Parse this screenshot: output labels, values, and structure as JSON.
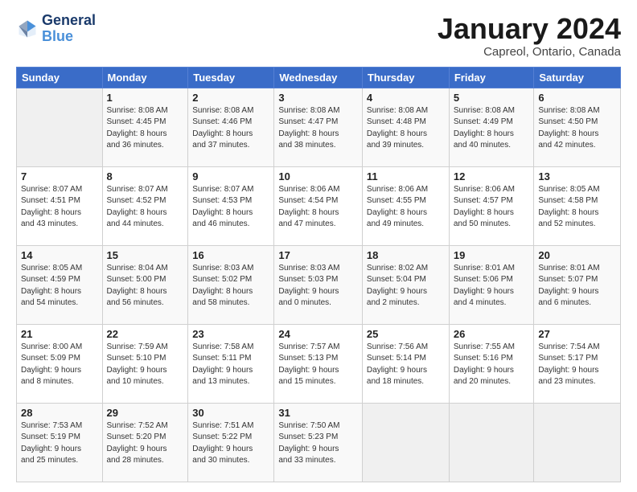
{
  "header": {
    "logo_line1": "General",
    "logo_line2": "Blue",
    "month_title": "January 2024",
    "location": "Capreol, Ontario, Canada"
  },
  "weekdays": [
    "Sunday",
    "Monday",
    "Tuesday",
    "Wednesday",
    "Thursday",
    "Friday",
    "Saturday"
  ],
  "weeks": [
    [
      {
        "day": "",
        "info": ""
      },
      {
        "day": "1",
        "info": "Sunrise: 8:08 AM\nSunset: 4:45 PM\nDaylight: 8 hours\nand 36 minutes."
      },
      {
        "day": "2",
        "info": "Sunrise: 8:08 AM\nSunset: 4:46 PM\nDaylight: 8 hours\nand 37 minutes."
      },
      {
        "day": "3",
        "info": "Sunrise: 8:08 AM\nSunset: 4:47 PM\nDaylight: 8 hours\nand 38 minutes."
      },
      {
        "day": "4",
        "info": "Sunrise: 8:08 AM\nSunset: 4:48 PM\nDaylight: 8 hours\nand 39 minutes."
      },
      {
        "day": "5",
        "info": "Sunrise: 8:08 AM\nSunset: 4:49 PM\nDaylight: 8 hours\nand 40 minutes."
      },
      {
        "day": "6",
        "info": "Sunrise: 8:08 AM\nSunset: 4:50 PM\nDaylight: 8 hours\nand 42 minutes."
      }
    ],
    [
      {
        "day": "7",
        "info": "Sunrise: 8:07 AM\nSunset: 4:51 PM\nDaylight: 8 hours\nand 43 minutes."
      },
      {
        "day": "8",
        "info": "Sunrise: 8:07 AM\nSunset: 4:52 PM\nDaylight: 8 hours\nand 44 minutes."
      },
      {
        "day": "9",
        "info": "Sunrise: 8:07 AM\nSunset: 4:53 PM\nDaylight: 8 hours\nand 46 minutes."
      },
      {
        "day": "10",
        "info": "Sunrise: 8:06 AM\nSunset: 4:54 PM\nDaylight: 8 hours\nand 47 minutes."
      },
      {
        "day": "11",
        "info": "Sunrise: 8:06 AM\nSunset: 4:55 PM\nDaylight: 8 hours\nand 49 minutes."
      },
      {
        "day": "12",
        "info": "Sunrise: 8:06 AM\nSunset: 4:57 PM\nDaylight: 8 hours\nand 50 minutes."
      },
      {
        "day": "13",
        "info": "Sunrise: 8:05 AM\nSunset: 4:58 PM\nDaylight: 8 hours\nand 52 minutes."
      }
    ],
    [
      {
        "day": "14",
        "info": "Sunrise: 8:05 AM\nSunset: 4:59 PM\nDaylight: 8 hours\nand 54 minutes."
      },
      {
        "day": "15",
        "info": "Sunrise: 8:04 AM\nSunset: 5:00 PM\nDaylight: 8 hours\nand 56 minutes."
      },
      {
        "day": "16",
        "info": "Sunrise: 8:03 AM\nSunset: 5:02 PM\nDaylight: 8 hours\nand 58 minutes."
      },
      {
        "day": "17",
        "info": "Sunrise: 8:03 AM\nSunset: 5:03 PM\nDaylight: 9 hours\nand 0 minutes."
      },
      {
        "day": "18",
        "info": "Sunrise: 8:02 AM\nSunset: 5:04 PM\nDaylight: 9 hours\nand 2 minutes."
      },
      {
        "day": "19",
        "info": "Sunrise: 8:01 AM\nSunset: 5:06 PM\nDaylight: 9 hours\nand 4 minutes."
      },
      {
        "day": "20",
        "info": "Sunrise: 8:01 AM\nSunset: 5:07 PM\nDaylight: 9 hours\nand 6 minutes."
      }
    ],
    [
      {
        "day": "21",
        "info": "Sunrise: 8:00 AM\nSunset: 5:09 PM\nDaylight: 9 hours\nand 8 minutes."
      },
      {
        "day": "22",
        "info": "Sunrise: 7:59 AM\nSunset: 5:10 PM\nDaylight: 9 hours\nand 10 minutes."
      },
      {
        "day": "23",
        "info": "Sunrise: 7:58 AM\nSunset: 5:11 PM\nDaylight: 9 hours\nand 13 minutes."
      },
      {
        "day": "24",
        "info": "Sunrise: 7:57 AM\nSunset: 5:13 PM\nDaylight: 9 hours\nand 15 minutes."
      },
      {
        "day": "25",
        "info": "Sunrise: 7:56 AM\nSunset: 5:14 PM\nDaylight: 9 hours\nand 18 minutes."
      },
      {
        "day": "26",
        "info": "Sunrise: 7:55 AM\nSunset: 5:16 PM\nDaylight: 9 hours\nand 20 minutes."
      },
      {
        "day": "27",
        "info": "Sunrise: 7:54 AM\nSunset: 5:17 PM\nDaylight: 9 hours\nand 23 minutes."
      }
    ],
    [
      {
        "day": "28",
        "info": "Sunrise: 7:53 AM\nSunset: 5:19 PM\nDaylight: 9 hours\nand 25 minutes."
      },
      {
        "day": "29",
        "info": "Sunrise: 7:52 AM\nSunset: 5:20 PM\nDaylight: 9 hours\nand 28 minutes."
      },
      {
        "day": "30",
        "info": "Sunrise: 7:51 AM\nSunset: 5:22 PM\nDaylight: 9 hours\nand 30 minutes."
      },
      {
        "day": "31",
        "info": "Sunrise: 7:50 AM\nSunset: 5:23 PM\nDaylight: 9 hours\nand 33 minutes."
      },
      {
        "day": "",
        "info": ""
      },
      {
        "day": "",
        "info": ""
      },
      {
        "day": "",
        "info": ""
      }
    ]
  ]
}
